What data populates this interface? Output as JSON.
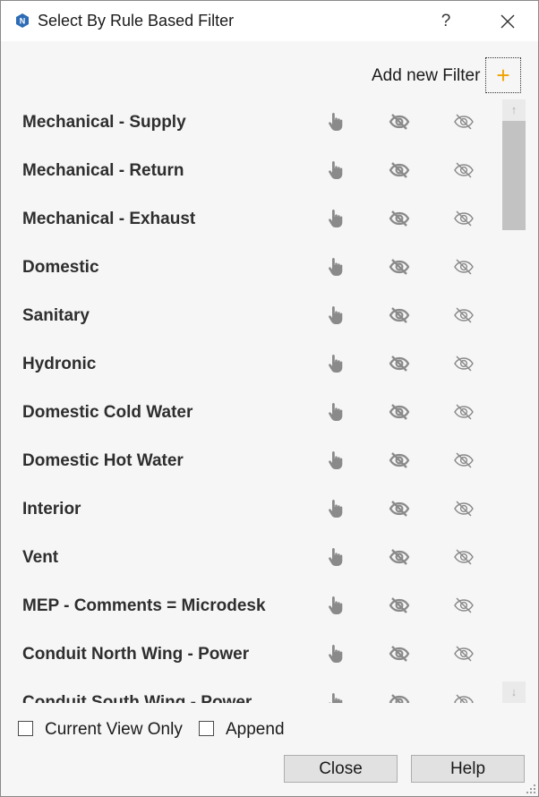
{
  "window": {
    "title": "Select By Rule Based Filter",
    "help_label": "?"
  },
  "toolbar": {
    "add_filter_label": "Add new Filter",
    "add_filter_icon": "+"
  },
  "filters": [
    {
      "label": "Mechanical - Supply"
    },
    {
      "label": "Mechanical - Return"
    },
    {
      "label": "Mechanical - Exhaust"
    },
    {
      "label": "Domestic"
    },
    {
      "label": "Sanitary"
    },
    {
      "label": "Hydronic"
    },
    {
      "label": "Domestic Cold Water"
    },
    {
      "label": "Domestic Hot Water"
    },
    {
      "label": "Interior"
    },
    {
      "label": "Vent"
    },
    {
      "label": "MEP - Comments = Microdesk"
    },
    {
      "label": "Conduit North Wing - Power"
    },
    {
      "label": "Conduit South Wing - Power"
    }
  ],
  "row_icons": [
    "hand-pointer-icon",
    "eye-hide-icon",
    "eye-unhide-icon"
  ],
  "options": {
    "current_view_only": {
      "label": "Current View Only",
      "checked": false
    },
    "append": {
      "label": "Append",
      "checked": false
    }
  },
  "buttons": {
    "close": "Close",
    "help": "Help"
  },
  "colors": {
    "accent_plus": "#f0a300",
    "icon_gray": "#8a8a8a"
  }
}
